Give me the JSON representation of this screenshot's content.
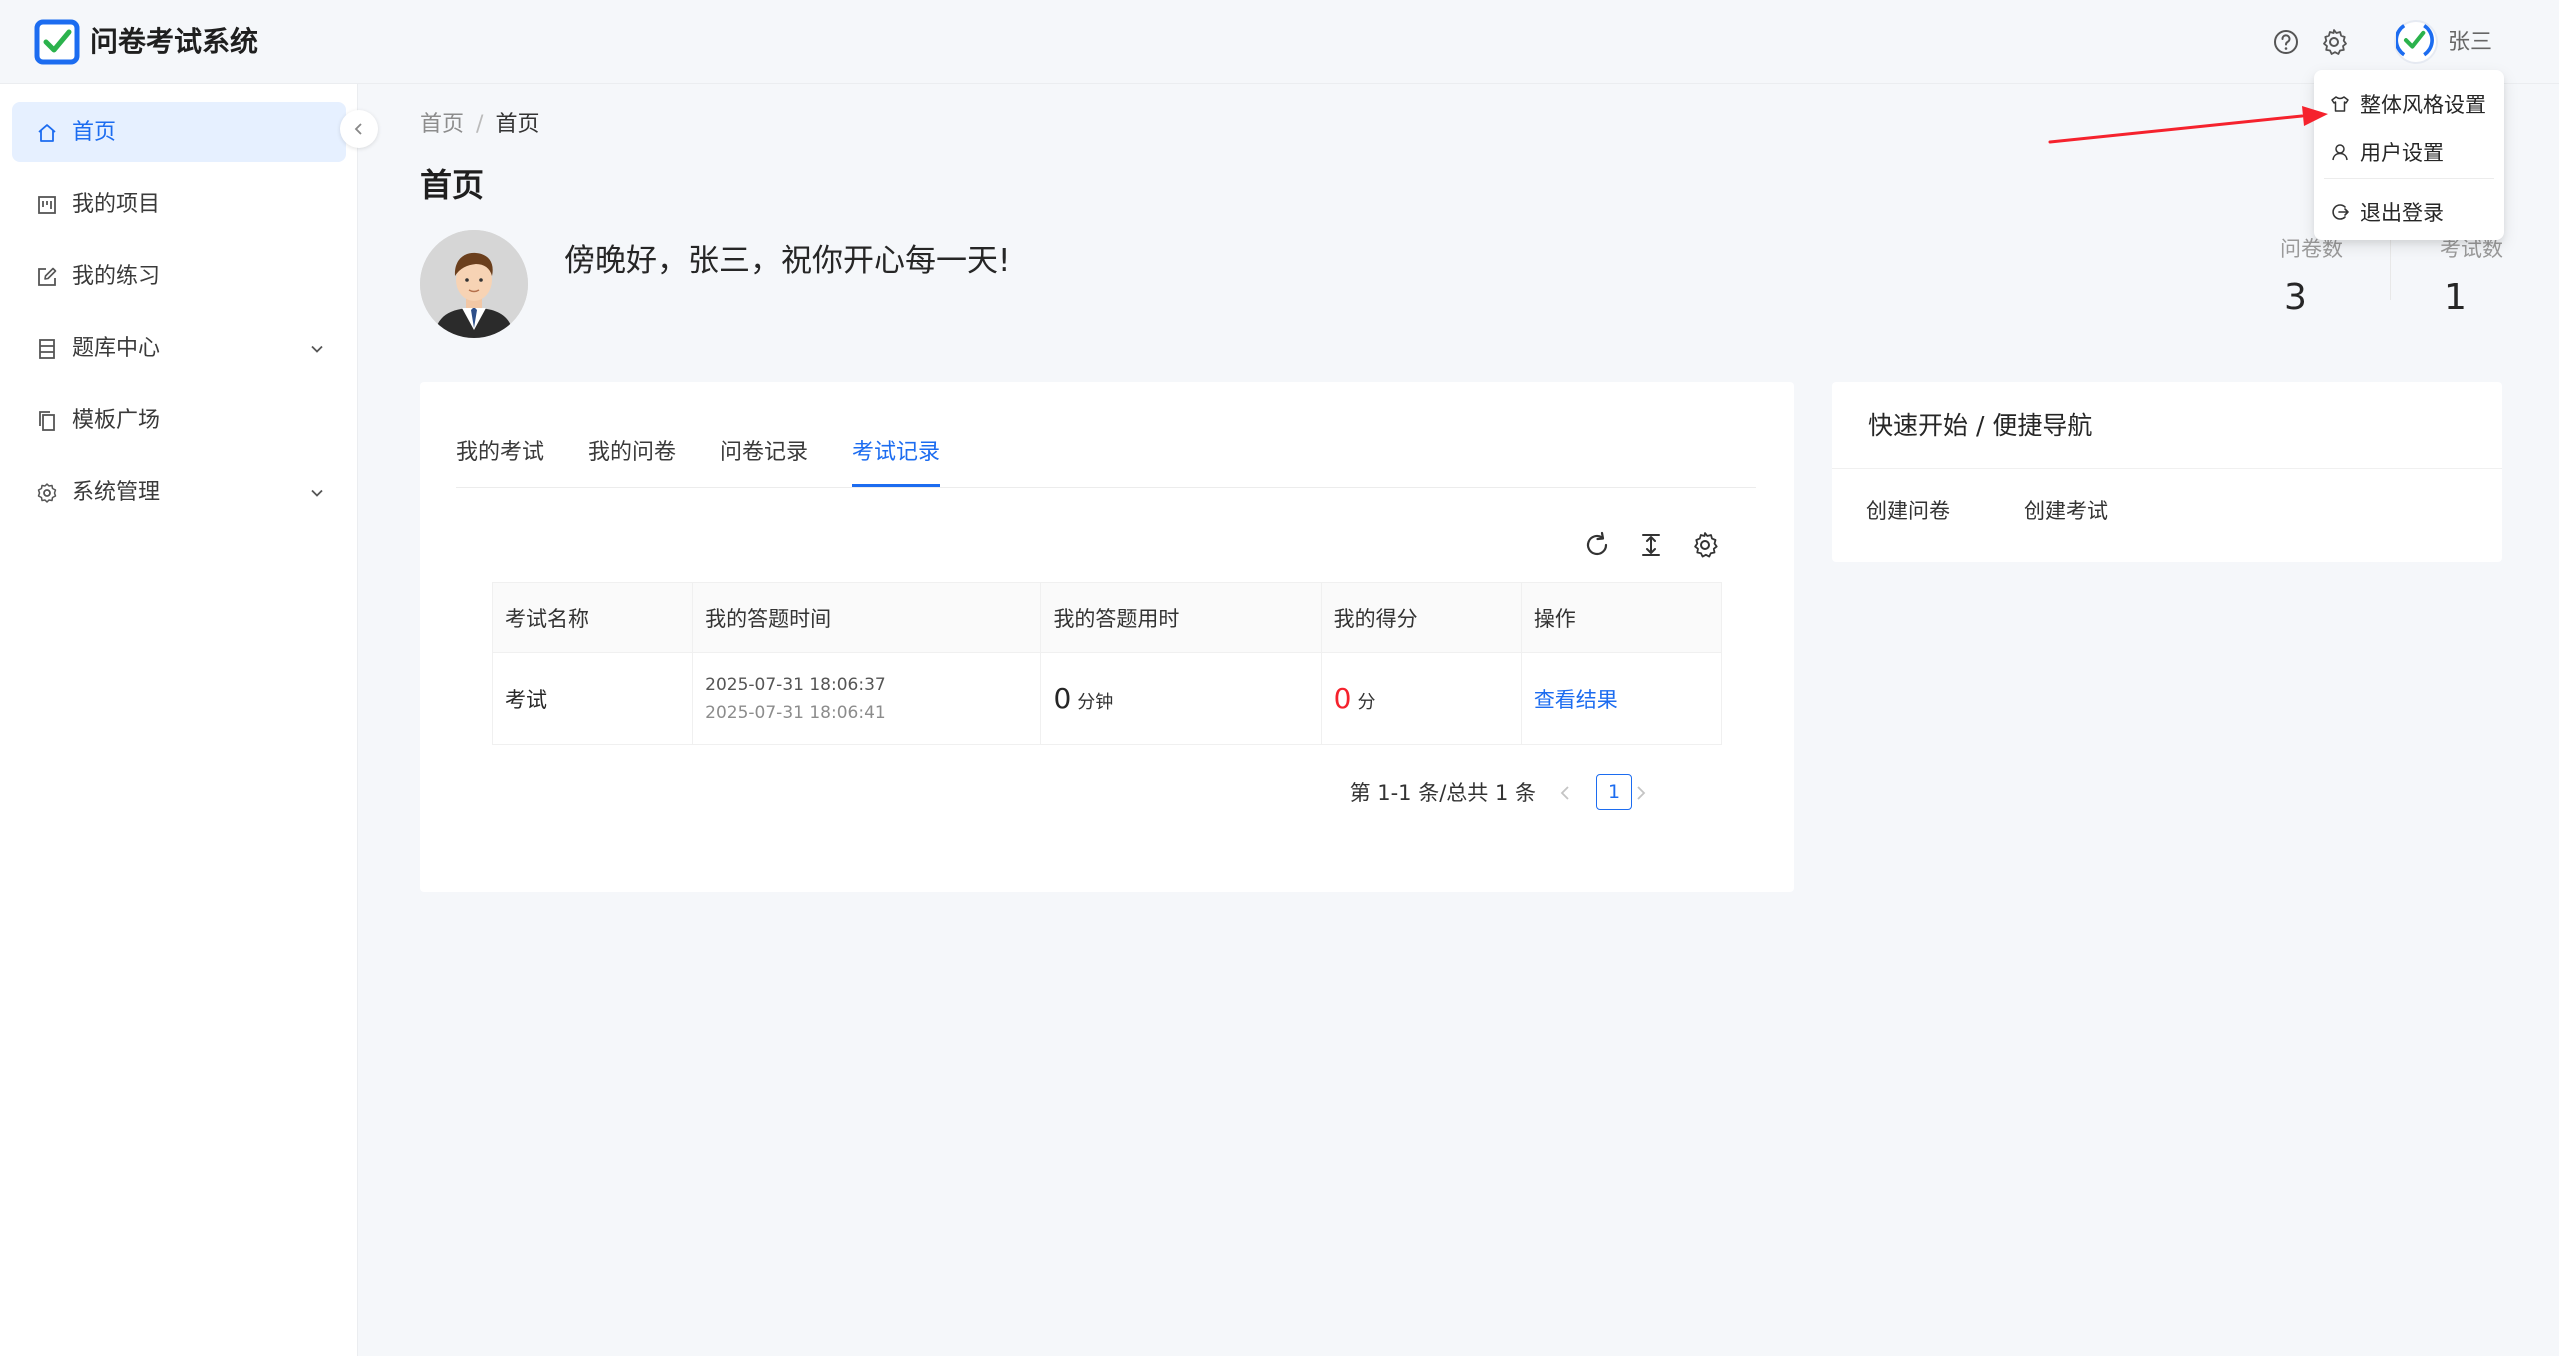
{
  "header": {
    "app_title": "问卷考试系统",
    "username": "张三",
    "icons": [
      "question-circle-icon",
      "gear-icon"
    ]
  },
  "user_menu": {
    "items": [
      {
        "icon": "skin-icon",
        "label": "整体风格设置"
      },
      {
        "icon": "user-icon",
        "label": "用户设置"
      },
      {
        "icon": "logout-icon",
        "label": "退出登录"
      }
    ]
  },
  "sidebar": {
    "items": [
      {
        "icon": "home-icon",
        "label": "首页",
        "active": true
      },
      {
        "icon": "project-icon",
        "label": "我的项目"
      },
      {
        "icon": "edit-icon",
        "label": "我的练习"
      },
      {
        "icon": "database-icon",
        "label": "题库中心",
        "expandable": true
      },
      {
        "icon": "copy-icon",
        "label": "模板广场"
      },
      {
        "icon": "setting-icon",
        "label": "系统管理",
        "expandable": true
      }
    ]
  },
  "breadcrumb": {
    "root": "首页",
    "sep": "/",
    "current": "首页"
  },
  "page_title": "首页",
  "greeting": "傍晚好，张三，祝你开心每一天!",
  "stats": [
    {
      "label": "问卷数",
      "value": "3"
    },
    {
      "label": "考试数",
      "value": "1"
    }
  ],
  "tabs": [
    {
      "label": "我的考试"
    },
    {
      "label": "我的问卷"
    },
    {
      "label": "问卷记录"
    },
    {
      "label": "考试记录",
      "active": true
    }
  ],
  "table": {
    "columns": [
      "考试名称",
      "我的答题时间",
      "我的答题用时",
      "我的得分",
      "操作"
    ],
    "rows": [
      {
        "name": "考试",
        "start_time": "2025-07-31 18:06:37",
        "end_time": "2025-07-31 18:06:41",
        "duration": "0",
        "duration_unit": "分钟",
        "score": "0",
        "score_unit": "分",
        "action": "查看结果"
      }
    ]
  },
  "pagination": {
    "summary": "第 1-1 条/总共 1 条",
    "current_page": "1"
  },
  "quick_start": {
    "title": "快速开始 / 便捷导航",
    "links": [
      "创建问卷",
      "创建考试"
    ]
  },
  "colors": {
    "primary": "#1c6cf0",
    "danger": "#f5222d",
    "annotation_arrow": "#f5222d"
  }
}
